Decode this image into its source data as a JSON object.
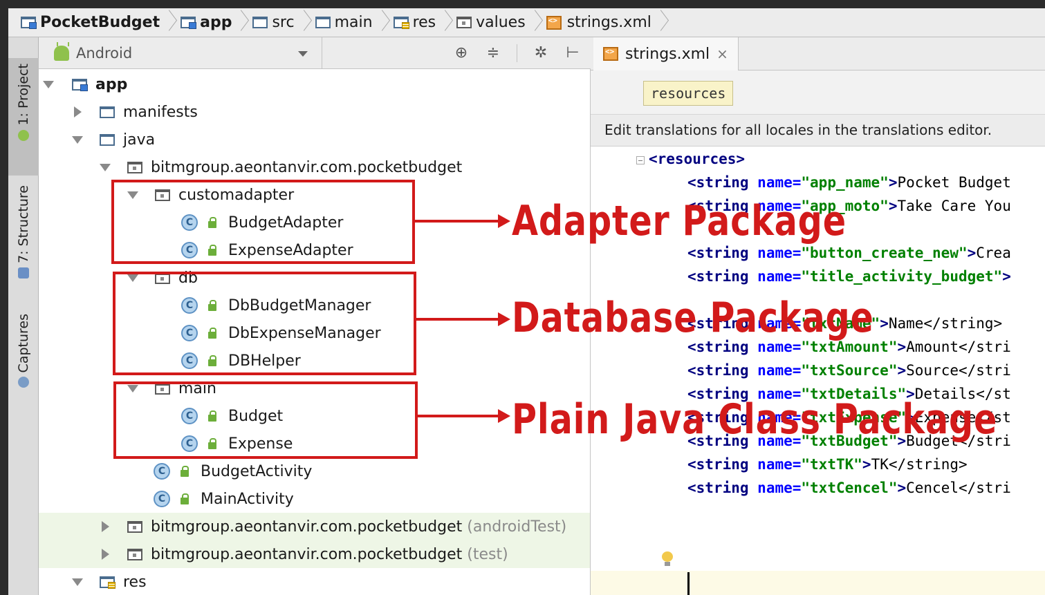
{
  "breadcrumb": [
    "PocketBudget",
    "app",
    "src",
    "main",
    "res",
    "values",
    "strings.xml"
  ],
  "stripe_tabs": [
    "1: Project",
    "7: Structure",
    "Captures"
  ],
  "project_view": {
    "selected": "Android"
  },
  "tree": [
    {
      "label": "app",
      "bold": true
    },
    {
      "label": "manifests"
    },
    {
      "label": "java"
    },
    {
      "label": "bitmgroup.aeontanvir.com.pocketbudget"
    },
    {
      "label": "customadapter"
    },
    {
      "label": "BudgetAdapter"
    },
    {
      "label": "ExpenseAdapter"
    },
    {
      "label": "db"
    },
    {
      "label": "DbBudgetManager"
    },
    {
      "label": "DbExpenseManager"
    },
    {
      "label": "DBHelper"
    },
    {
      "label": "main"
    },
    {
      "label": "Budget"
    },
    {
      "label": "Expense"
    },
    {
      "label": "BudgetActivity"
    },
    {
      "label": "MainActivity"
    },
    {
      "label": "bitmgroup.aeontanvir.com.pocketbudget",
      "suffix": "(androidTest)"
    },
    {
      "label": "bitmgroup.aeontanvir.com.pocketbudget",
      "suffix": "(test)"
    },
    {
      "label": "res"
    }
  ],
  "editor": {
    "tab_label": "strings.xml",
    "close_glyph": "×",
    "breadcrumb_chip": "resources",
    "notice": "Edit translations for all locales in the translations editor.",
    "code_lines": [
      {
        "indent": 0,
        "raw": "<resources>"
      },
      {
        "indent": 1,
        "name": "app_name",
        "content": "Pocket Budget"
      },
      {
        "indent": 1,
        "name": "app_moto",
        "content": "Take Care You"
      },
      {
        "indent": 0,
        "raw": ""
      },
      {
        "indent": 1,
        "name": "button_create_new",
        "content": "Crea"
      },
      {
        "indent": 1,
        "name": "title_activity_budget",
        "content": ""
      },
      {
        "indent": 0,
        "raw": ""
      },
      {
        "indent": 1,
        "name": "txtName",
        "content": "Name</string>"
      },
      {
        "indent": 1,
        "name": "txtAmount",
        "content": "Amount</stri"
      },
      {
        "indent": 1,
        "name": "txtSource",
        "content": "Source</stri"
      },
      {
        "indent": 1,
        "name": "txtDetails",
        "content": "Details</st"
      },
      {
        "indent": 1,
        "name": "txtExpense",
        "content": "Expense</st"
      },
      {
        "indent": 1,
        "name": "txtBudget",
        "content": "Budget</stri"
      },
      {
        "indent": 1,
        "name": "txtTK",
        "content": "TK</string>"
      },
      {
        "indent": 1,
        "name": "txtCencel",
        "content": "Cencel</stri"
      }
    ]
  },
  "annotations": {
    "adapter_label": "Adapter Package",
    "database_label": "Database Package",
    "plain_label": "Plain Java Class Package",
    "color": "#d21a1a"
  }
}
